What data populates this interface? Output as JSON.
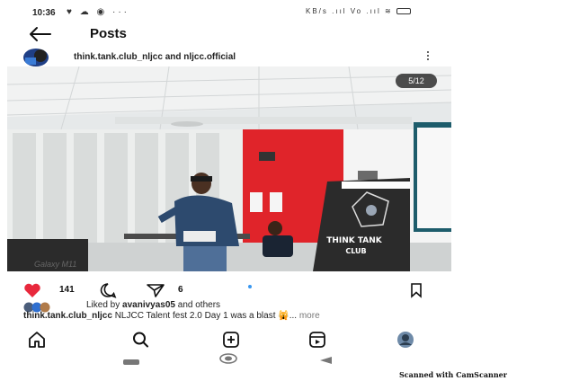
{
  "status_bar": {
    "time": "10:36",
    "left_icons": "♥ ☁ ◉ ···",
    "right_text": "KB/s .ııl Vo .ııl ≋"
  },
  "header": {
    "title": "Posts"
  },
  "post": {
    "author": "think.tank.club_nljcc and nljcc.official",
    "counter": "5/12",
    "camera_watermark": "Galaxy M11",
    "banner_line1": "THINK TANK",
    "banner_line2": "CLUB",
    "likes": "141",
    "shares": "6",
    "liked_by_prefix": "Liked by",
    "liked_by_user": "avanivyas05",
    "liked_by_suffix": "and others",
    "caption_user": "think.tank.club_nljcc",
    "caption_text": "NLJCC Talent fest 2.0 Day 1 was a blast 🙀... ",
    "more_label": "more"
  },
  "footer": {
    "scanned": "Scanned with CamScanner"
  },
  "colors": {
    "like": "#e8283c",
    "wall_red": "#e0242a",
    "banner_dark": "#2b2b2b"
  }
}
